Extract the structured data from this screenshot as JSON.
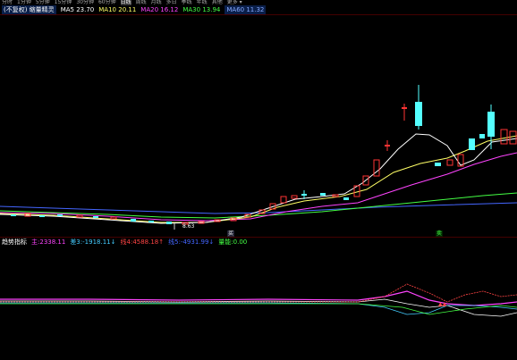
{
  "top_tabs": [
    "分时",
    "1分钟",
    "5分钟",
    "15分钟",
    "30分钟",
    "60分钟",
    "日线",
    "周线",
    "月线",
    "多日",
    "季线",
    "年线",
    "其他",
    "更多 ▾"
  ],
  "active_tab": 6,
  "legend": {
    "title": "(不复权) 缩量精灵",
    "items": [
      {
        "label": "MA5",
        "value": "23.70",
        "color": "#ffffff"
      },
      {
        "label": "MA10",
        "value": "20.11",
        "color": "#ffff66"
      },
      {
        "label": "MA20",
        "value": "16.12",
        "color": "#ff44ff"
      },
      {
        "label": "MA30",
        "value": "13.94",
        "color": "#44ff44"
      },
      {
        "label": "MA60",
        "value": "11.32",
        "color": "#4488ff"
      }
    ]
  },
  "sub_legend": {
    "title": "趋势指标",
    "items": [
      {
        "label": "主",
        "value": "2338.11",
        "color": "#ff44ff"
      },
      {
        "label": "差3",
        "value": "-1918.11↓",
        "color": "#44ccff"
      },
      {
        "label": "线4",
        "value": "4588.18↑",
        "color": "#ff4444"
      },
      {
        "label": "线5",
        "value": "-4931.99↓",
        "color": "#4466ff"
      },
      {
        "label": "量能",
        "value": "0.00",
        "color": "#44ff44"
      }
    ]
  },
  "price_low_label": "8.63",
  "markers": [
    {
      "label": "买"
    },
    {
      "label": "卖"
    }
  ],
  "colors": {
    "up": "#ff3333",
    "down": "#54ffff",
    "bg": "#000000"
  }
}
